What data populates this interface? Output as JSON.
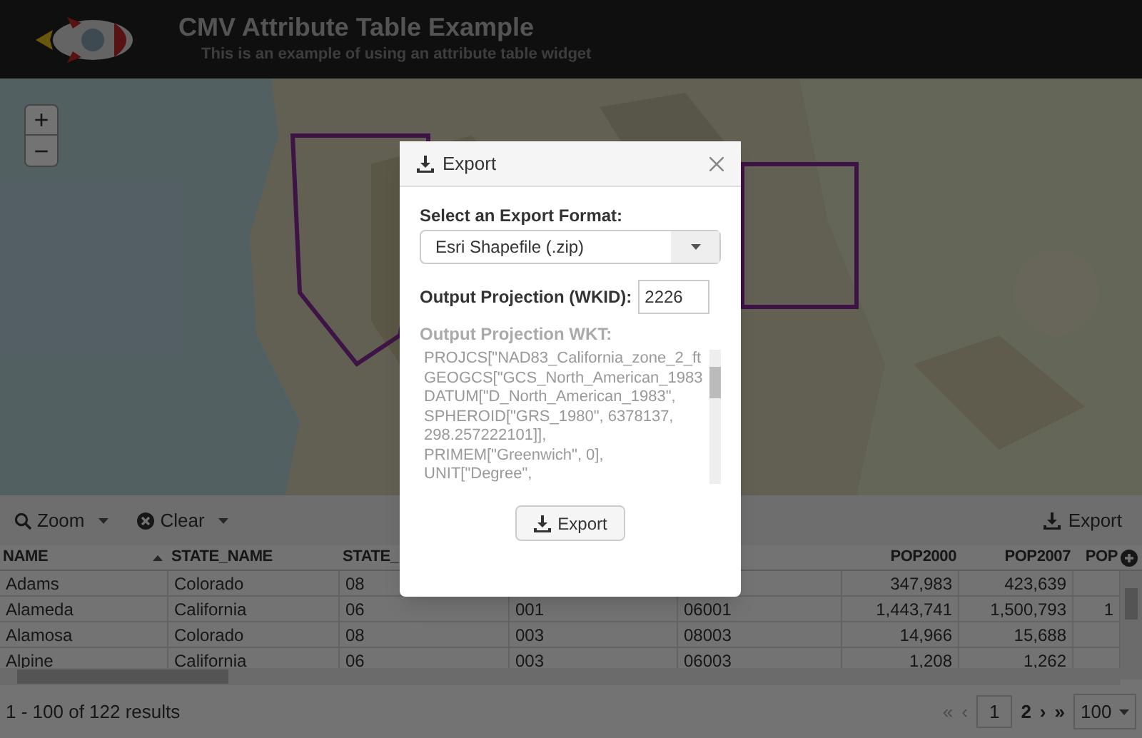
{
  "header": {
    "title": "CMV Attribute Table Example",
    "subtitle": "This is an example of using an attribute table widget"
  },
  "map": {
    "zoom_in": "+",
    "zoom_out": "−"
  },
  "toolbar": {
    "zoom": "Zoom",
    "clear": "Clear",
    "export": "Export"
  },
  "table": {
    "columns": [
      {
        "label": "NAME",
        "sorted": true
      },
      {
        "label": "STATE_NAME"
      },
      {
        "label": "STATE_"
      },
      {},
      {},
      {
        "label": "POP2000"
      },
      {
        "label": "POP2007"
      },
      {
        "label": "POP"
      }
    ],
    "rows": [
      [
        "Adams",
        "Colorado",
        "08",
        "",
        "",
        "347,983",
        "423,639",
        ""
      ],
      [
        "Alameda",
        "California",
        "06",
        "001",
        "06001",
        "1,443,741",
        "1,500,793",
        "1"
      ],
      [
        "Alamosa",
        "Colorado",
        "08",
        "003",
        "08003",
        "14,966",
        "15,688",
        ""
      ],
      [
        "Alpine",
        "California",
        "06",
        "003",
        "06003",
        "1,208",
        "1,262",
        ""
      ]
    ]
  },
  "footer": {
    "results": "1 - 100 of 122 results",
    "first": "«",
    "prev": "‹",
    "page": "1",
    "next_page": "2",
    "next": "›",
    "last": "»",
    "page_size": "100"
  },
  "dialog": {
    "title": "Export",
    "format_label": "Select an Export Format:",
    "format_value": "Esri Shapefile (.zip)",
    "wkid_label": "Output Projection (WKID):",
    "wkid_value": "2226",
    "wkt_label": "Output Projection WKT:",
    "wkt_lines": [
      "PROJCS[\"NAD83_California_zone_2_ft",
      "GEOGCS[\"GCS_North_American_1983",
      "DATUM[\"D_North_American_1983\",",
      "SPHEROID[\"GRS_1980\", 6378137,",
      "298.257222101]],",
      "PRIMEM[\"Greenwich\", 0],",
      "UNIT[\"Degree\","
    ],
    "button": "Export"
  }
}
